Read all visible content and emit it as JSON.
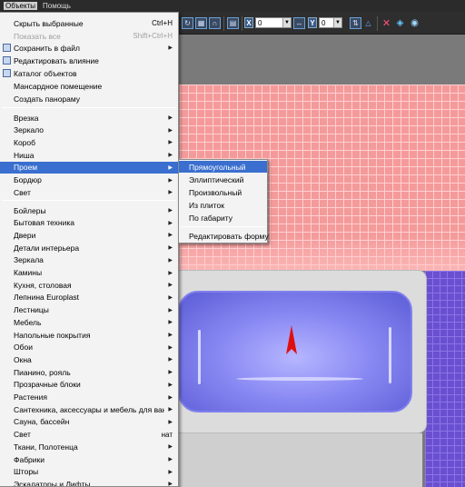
{
  "menubar": {
    "items": [
      "Объекты",
      "Помощь"
    ]
  },
  "toolbar": {
    "x_label": "X",
    "x_value": "0",
    "y_label": "Y",
    "y_value": "0",
    "icons": [
      "rotate-icon",
      "magnet-icon",
      "grid-icon",
      "triangle-icon",
      "delete-icon",
      "snap-icon",
      "eye-icon"
    ]
  },
  "main_menu": {
    "hide_selected": "Скрыть выбранные",
    "hide_selected_sc": "Ctrl+H",
    "show_all": "Показать все",
    "show_all_sc": "Shift+Ctrl+H",
    "save_to_file": "Сохранить в файл",
    "edit_influence": "Редактировать влияние",
    "catalog": "Каталог объектов",
    "attic": "Мансардное помещение",
    "panorama": "Создать панораму",
    "group1": [
      "Врезка",
      "Зеркало",
      "Короб",
      "Ниша",
      "Проем",
      "Бордюр",
      "Свет"
    ],
    "group2": [
      "Бойлеры",
      "Бытовая техника",
      "Двери",
      "Детали интерьера",
      "Зеркала",
      "Камины",
      "Кухня, столовая",
      "Лепнина Europlast",
      "Лестницы",
      "Мебель",
      "Напольные покрытия",
      "Обои",
      "Окна",
      "Пианино, рояль",
      "Прозрачные блоки",
      "Растения",
      "Сантехника, аксессуары и мебель для ванных ком",
      "Сауна, бассейн",
      "Свет",
      "Ткани, Полотенца",
      "Фабрики",
      "Шторы",
      "Эскалаторы и Лифты"
    ],
    "light_shortcut": "нат"
  },
  "sub_menu": {
    "items": [
      "Прямоугольный",
      "Эллиптический",
      "Произвольный",
      "Из плиток",
      "По габариту"
    ],
    "edit_shape": "Редактировать форму"
  }
}
